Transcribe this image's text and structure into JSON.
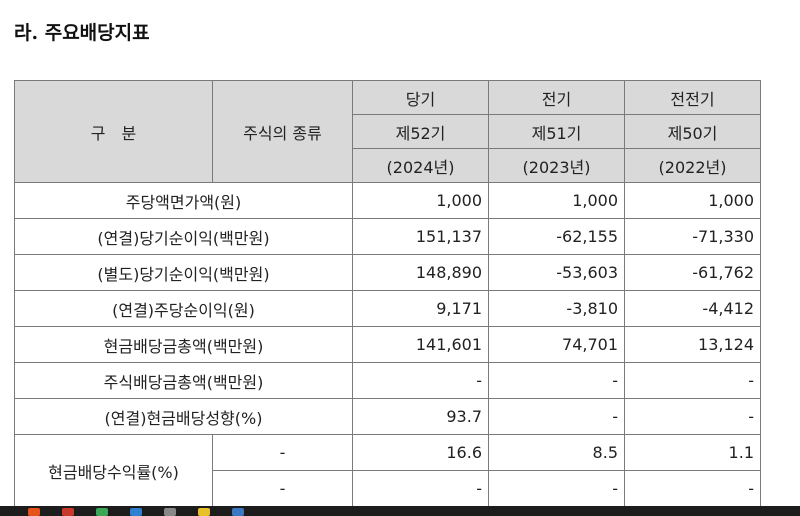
{
  "section_title": "라. 주요배당지표",
  "table": {
    "header": {
      "category": "구　분",
      "stock_type": "주식의 종류",
      "periods": [
        {
          "name": "당기",
          "term": "제52기",
          "year": "(2024년)"
        },
        {
          "name": "전기",
          "term": "제51기",
          "year": "(2023년)"
        },
        {
          "name": "전전기",
          "term": "제50기",
          "year": "(2022년)"
        }
      ]
    },
    "rows": [
      {
        "label": "주당액면가액(원)",
        "values": [
          "1,000",
          "1,000",
          "1,000"
        ]
      },
      {
        "label": "(연결)당기순이익(백만원)",
        "values": [
          "151,137",
          "-62,155",
          "-71,330"
        ]
      },
      {
        "label": "(별도)당기순이익(백만원)",
        "values": [
          "148,890",
          "-53,603",
          "-61,762"
        ]
      },
      {
        "label": "(연결)주당순이익(원)",
        "values": [
          "9,171",
          "-3,810",
          "-4,412"
        ]
      },
      {
        "label": "현금배당금총액(백만원)",
        "values": [
          "141,601",
          "74,701",
          "13,124"
        ]
      },
      {
        "label": "주식배당금총액(백만원)",
        "values": [
          "-",
          "-",
          "-"
        ]
      },
      {
        "label": "(연결)현금배당성향(%)",
        "values": [
          "93.7",
          "-",
          "-"
        ]
      }
    ],
    "yield_row": {
      "label": "현금배당수익률(%)",
      "sub_rows": [
        {
          "stock_type": "-",
          "values": [
            "16.6",
            "8.5",
            "1.1"
          ]
        },
        {
          "stock_type": "-",
          "values": [
            "-",
            "-",
            "-"
          ]
        }
      ]
    }
  }
}
